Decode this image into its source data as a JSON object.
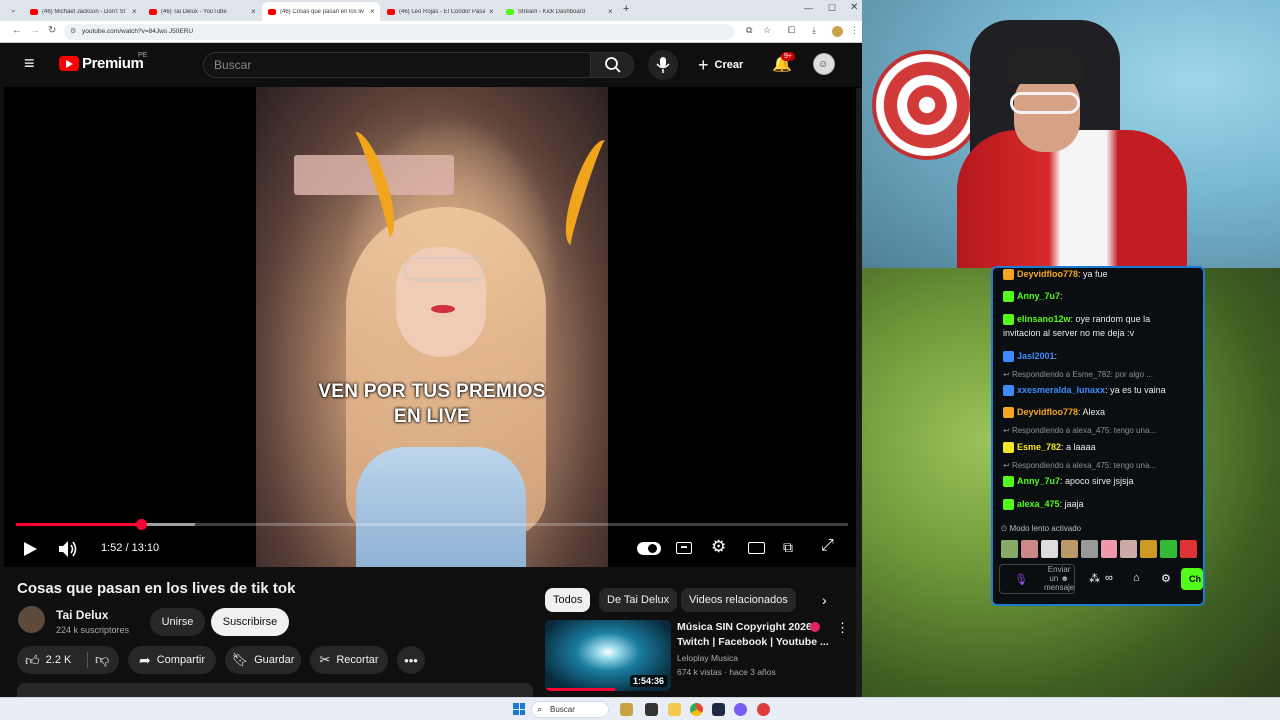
{
  "browser": {
    "tabs": [
      {
        "label": "(46) Michael Jackson - Don't St",
        "type": "youtube"
      },
      {
        "label": "(46) Tai Delux - YouTube",
        "type": "youtube"
      },
      {
        "label": "(46) Cosas que pasan en los liv",
        "type": "youtube",
        "active": true
      },
      {
        "label": "(46) Leo Rojas - El Condor Pasa",
        "type": "youtube"
      },
      {
        "label": "Stream - Kick Dashboard",
        "type": "kick"
      }
    ],
    "new_tab": "+",
    "url": "youtube.com/watch?v=84Jws J50ERU"
  },
  "youtube": {
    "logo": "Premium",
    "logo_region": "PE",
    "search_placeholder": "Buscar",
    "create_label": "Crear",
    "notification_count": "9+",
    "video": {
      "caption_line1": "VEN POR TUS PREMIOS",
      "caption_line2": "EN LIVE",
      "time": "1:52 / 13:10",
      "progress_played": 0.15,
      "progress_buffered": 0.215
    },
    "title": "Cosas que pasan en los lives de tik tok",
    "channel": {
      "name": "Tai Delux",
      "subscribers": "224 k suscriptores",
      "join": "Unirse",
      "subscribe": "Suscribirse"
    },
    "actions": {
      "likes": "2.2 K",
      "share": "Compartir",
      "save": "Guardar",
      "clip": "Recortar"
    },
    "chips": [
      "Todos",
      "De Tai Delux",
      "Videos relacionados"
    ],
    "recommended": {
      "title_line1": "Música SIN Copyright 2026",
      "title_line2": "Twitch | Facebook | Youtube ...",
      "channel": "Leloplay Musica",
      "meta": "674 k vistas · hace 3 años",
      "duration": "1:54:36"
    }
  },
  "chat": {
    "messages": [
      {
        "kind": "msg",
        "user": "Deyvidfloo778",
        "color": "#f5a623",
        "text": ": ya fue"
      },
      {
        "kind": "msg",
        "user": "Anny_7u7",
        "color": "#53fc18",
        "text": ":"
      },
      {
        "kind": "msg",
        "user": "elinsano12w",
        "color": "#53fc18",
        "text": ": oye random que la"
      },
      {
        "kind": "cont",
        "text": "invitacion al server no me deja :v"
      },
      {
        "kind": "msg",
        "user": "Jasl2001",
        "color": "#3d8bff",
        "text": ":"
      },
      {
        "kind": "reply",
        "text": "Respondiendo a Esme_782: por algo ..."
      },
      {
        "kind": "msg",
        "user": "xxesmeralda_lunaxx",
        "color": "#3d8bff",
        "text": ": ya es tu vaina"
      },
      {
        "kind": "msg",
        "user": "Deyvidfloo778",
        "color": "#f5a623",
        "text": ": Alexa"
      },
      {
        "kind": "reply",
        "text": "Respondiendo a alexa_475: tengo una..."
      },
      {
        "kind": "msg",
        "user": "Esme_782",
        "color": "#f5e623",
        "text": ": a laaaa"
      },
      {
        "kind": "reply",
        "text": "Respondiendo a alexa_475: tengo una..."
      },
      {
        "kind": "msg",
        "user": "Anny_7u7",
        "color": "#53fc18",
        "text": ": apoco sirve jsjsja"
      },
      {
        "kind": "msg",
        "user": "alexa_475",
        "color": "#53fc18",
        "text": ": jaaja"
      }
    ],
    "slow_mode": "Modo lento activado",
    "input_placeholder_1": "Enviar",
    "input_placeholder_2": "un",
    "input_placeholder_3": "mensaje",
    "send_label": "Ch"
  },
  "taskbar": {
    "search": "Buscar"
  }
}
